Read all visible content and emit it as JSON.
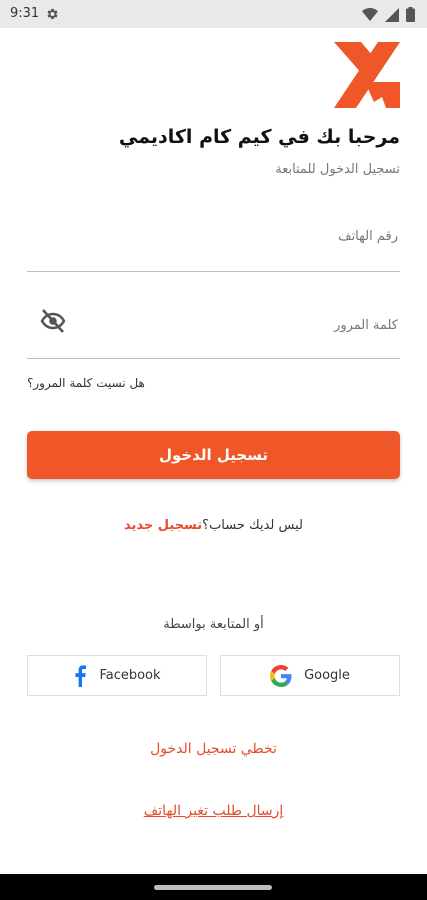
{
  "status_bar": {
    "time": "9:31",
    "icons": [
      "gear-icon",
      "wifi-icon",
      "signal-icon",
      "battery-icon"
    ]
  },
  "logo": {
    "icon": "kimkam-logo",
    "color": "#ef5628"
  },
  "welcome": {
    "title": "مرحبا بك في كيم كام اكاديمي",
    "subtitle": "تسجيل الدخول للمتابعة"
  },
  "form": {
    "phone_placeholder": "رقم الهاتف",
    "phone_value": "",
    "password_placeholder": "كلمة المرور",
    "password_value": "",
    "password_toggle_icon": "eye-off-icon",
    "forgot_password": "هل نسيت كلمة المرور؟",
    "login_button": "تسجيل الدخول"
  },
  "signup": {
    "prompt": "ليس لديك حساب؟",
    "link": "تسجيل جديد"
  },
  "social": {
    "or_label": "أو المتابعة بواسطة",
    "facebook": "Facebook",
    "google": "Google"
  },
  "links": {
    "skip_login": "تخطي تسجيل الدخول",
    "change_phone": "إرسال طلب تغير الهاتف"
  },
  "colors": {
    "accent": "#ef5628",
    "link": "#e74c2c",
    "facebook": "#1877f2"
  }
}
